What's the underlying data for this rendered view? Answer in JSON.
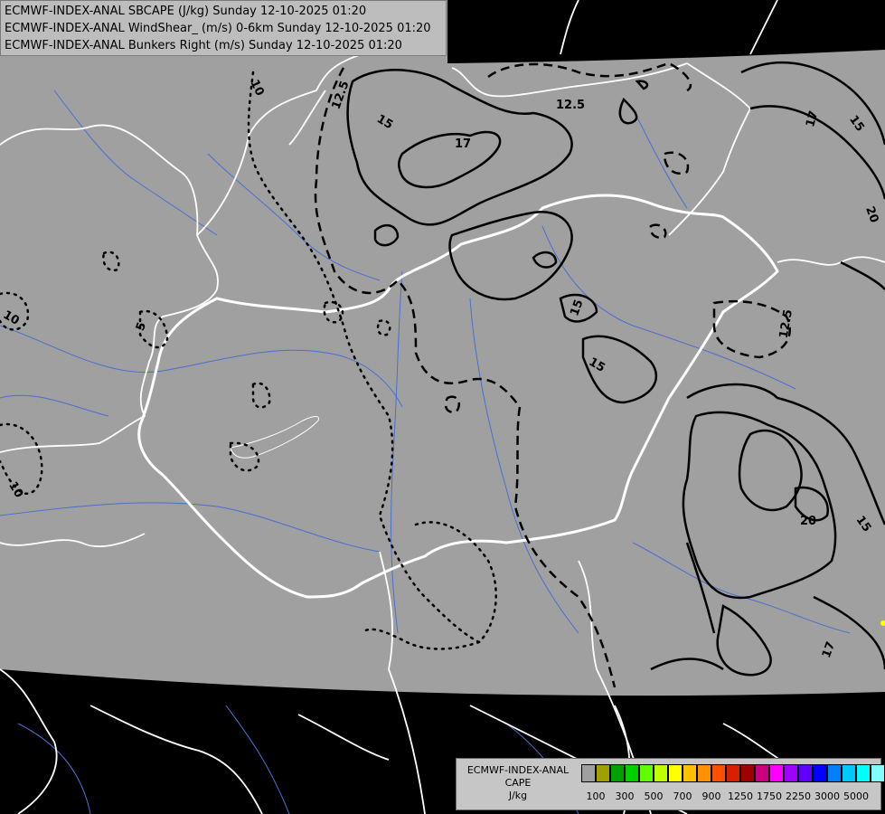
{
  "header": {
    "lines": [
      "ECMWF-INDEX-ANAL SBCAPE (J/kg) Sunday 12-10-2025 01:20",
      "ECMWF-INDEX-ANAL WindShear_ (m/s) 0-6km Sunday 12-10-2025 01:20",
      "ECMWF-INDEX-ANAL Bunkers Right (m/s) Sunday 12-10-2025 01:20"
    ]
  },
  "legend": {
    "name_lines": [
      "ECMWF-INDEX-ANAL",
      "CAPE",
      "J/kg"
    ],
    "colors": [
      "#a0a0a0",
      "#a0a000",
      "#00a000",
      "#00d000",
      "#60ff00",
      "#c0ff00",
      "#ffff00",
      "#ffc000",
      "#ff9000",
      "#ff5000",
      "#d82000",
      "#a00000",
      "#c80080",
      "#ff00ff",
      "#a000ff",
      "#6000ff",
      "#0000ff",
      "#0080ff",
      "#00c8ff",
      "#00ffff",
      "#80ffff",
      "#ffffff"
    ],
    "tick_labels": [
      "100",
      "300",
      "500",
      "700",
      "900",
      "1250",
      "1750",
      "2250",
      "3000",
      "5000"
    ]
  },
  "map": {
    "background_color": "#a0a0a0",
    "outside_color": "#000000",
    "contour_labels": [
      "10",
      "12.5",
      "15",
      "17",
      "12.5",
      "17",
      "15",
      "20",
      "5",
      "10",
      "15",
      "12.5",
      "15",
      "20",
      "15",
      "10",
      "17"
    ]
  }
}
